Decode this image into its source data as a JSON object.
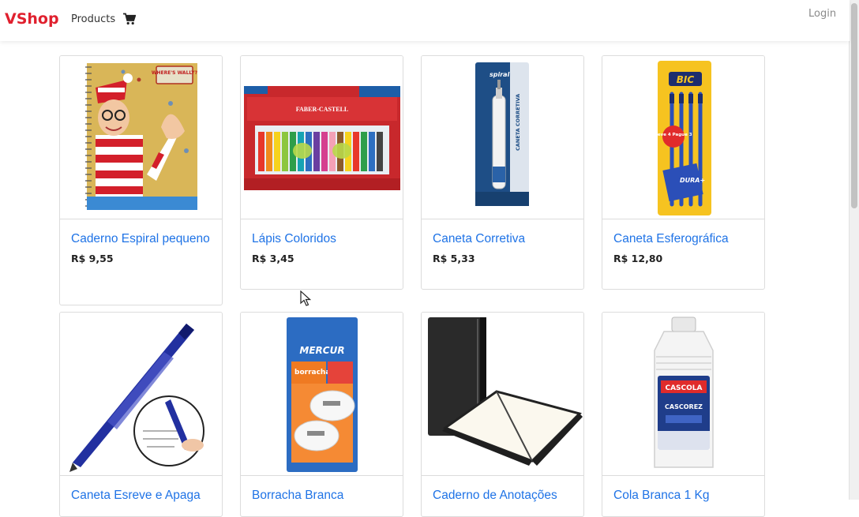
{
  "navbar": {
    "brand": "VShop",
    "products_label": "Products",
    "cart_icon": "shopping-cart-icon",
    "login_label": "Login"
  },
  "products": [
    {
      "name": "Caderno Espiral pequeno",
      "price": "R$ 9,55",
      "image": "notebook-wheres-wally-image"
    },
    {
      "name": "Lápis Coloridos",
      "price": "R$ 3,45",
      "image": "colored-pencils-image"
    },
    {
      "name": "Caneta Corretiva",
      "price": "R$ 5,33",
      "image": "correction-pen-image"
    },
    {
      "name": "Caneta Esferográfica",
      "price": "R$ 12,80",
      "image": "ballpoint-pens-image"
    },
    {
      "name": "Caneta Esreve e Apaga",
      "price": "",
      "image": "erasable-pen-image"
    },
    {
      "name": "Borracha Branca",
      "price": "",
      "image": "white-eraser-image"
    },
    {
      "name": "Caderno de Anotações",
      "price": "",
      "image": "notes-notebook-image"
    },
    {
      "name": "Cola Branca 1 Kg",
      "price": "",
      "image": "white-glue-image"
    }
  ],
  "image_texts": {
    "wally": "WHERE'S WALLY?",
    "faber": "FABER-CASTELL",
    "spiral": "spiral",
    "corretiva": "CANETA CORRETIVA",
    "bic": "BIC",
    "leve": "Leve 4 Pague 3",
    "dura": "DURA+",
    "mercur": "MERCUR",
    "borracha": "borracha",
    "cascola": "CASCOLA",
    "cascorez": "CASCOREZ"
  },
  "colors": {
    "brand": "#e0202e",
    "link": "#1f73e6",
    "price": "#222222"
  }
}
